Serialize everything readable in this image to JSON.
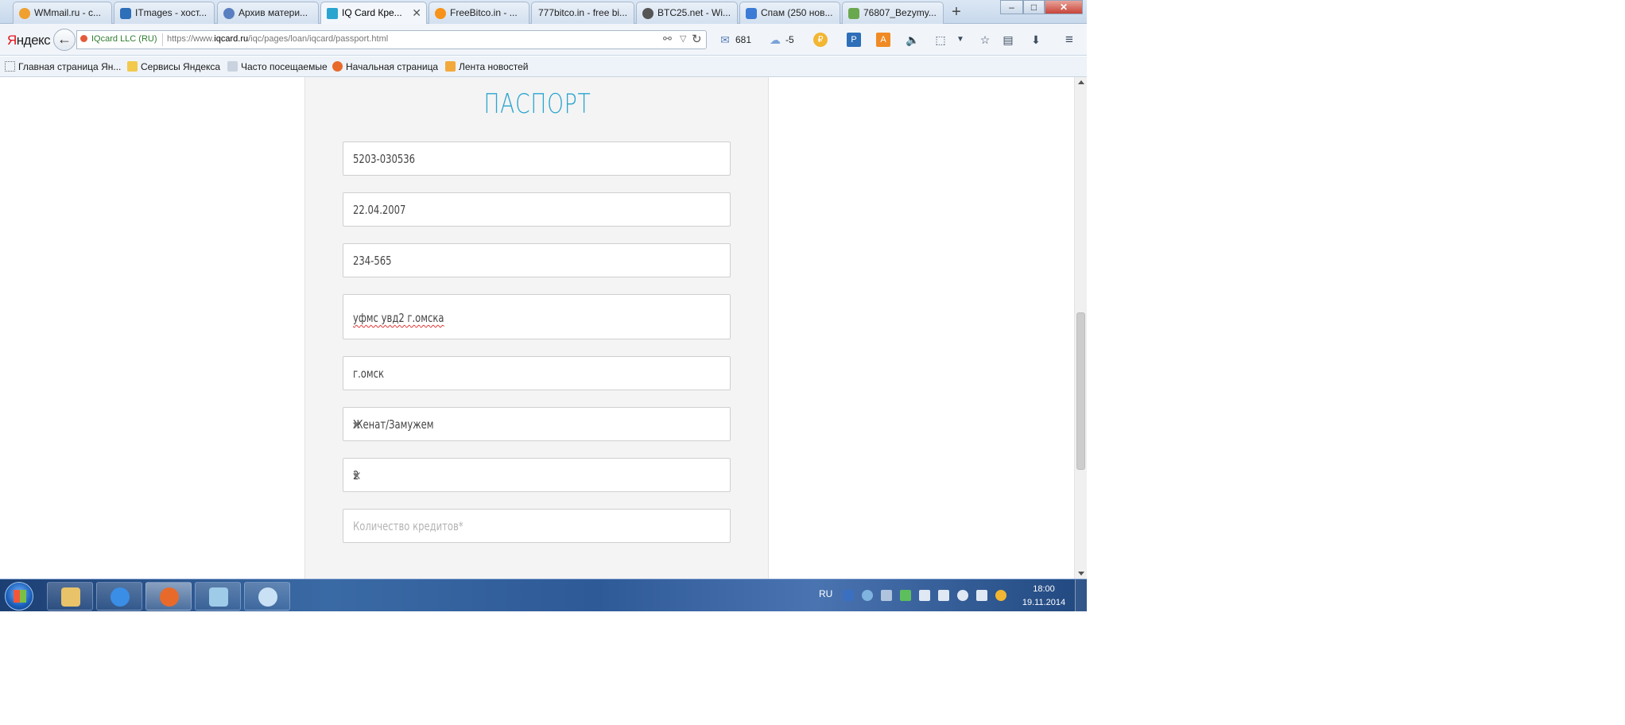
{
  "browser": {
    "tabs": [
      {
        "label": "WMmail.ru - с...",
        "icon_color": "#f0a030"
      },
      {
        "label": "ITmages - хост...",
        "icon_color": "#2d6fb8"
      },
      {
        "label": "Архив матери...",
        "icon_color": "#5a7fc0"
      },
      {
        "label": "IQ Card Кре...",
        "icon_color": "#2aa5cf",
        "active": true
      },
      {
        "label": "FreeBitco.in - ...",
        "icon_color": "#f7931a"
      },
      {
        "label": "777bitco.in - free bi...",
        "icon_color": "#d9d9d9"
      },
      {
        "label": "BTC25.net - Wi...",
        "icon_color": "#555555"
      },
      {
        "label": "Спам (250 нов...",
        "icon_color": "#3b7bd6"
      },
      {
        "label": "76807_Bezymy...",
        "icon_color": "#6aa84f"
      }
    ],
    "new_tab": "+",
    "window_buttons": {
      "minimize": "–",
      "maximize": "□",
      "close": "✕"
    },
    "nav": {
      "yandex_logo_first": "Я",
      "yandex_logo_rest": "ндекс",
      "site_identity": "IQcard LLC (RU)",
      "url_prefix": "https://www.",
      "url_domain": "iqcard.ru",
      "url_path": "/iqc/pages/loan/iqcard/passport.html",
      "mail_count": "681",
      "weather": "-5"
    },
    "bookmarks": [
      {
        "label": "Главная страница Ян...",
        "icon_color": "#ffffff"
      },
      {
        "label": "Сервисы Яндекса",
        "icon_color": "#f2c94c"
      },
      {
        "label": "Часто посещаемые",
        "icon_color": "#9aa7b8"
      },
      {
        "label": "Начальная страница",
        "icon_color": "#e86a2b"
      },
      {
        "label": "Лента новостей",
        "icon_color": "#f2a93b"
      }
    ]
  },
  "page": {
    "title": "ПАСПОРТ",
    "fields": [
      {
        "value": "5203-030536"
      },
      {
        "value": "22.04.2007"
      },
      {
        "value": "234-565"
      },
      {
        "value": "уфмс увд2 г.омска"
      },
      {
        "value": "г.омск"
      }
    ],
    "marital_status": {
      "value": "Женат/Замужем",
      "clear": "×"
    },
    "dependents": {
      "value": "2",
      "clear": "×"
    },
    "credits_count": {
      "placeholder": "Количество кредитов*"
    }
  },
  "taskbar": {
    "language": "RU",
    "time": "18:00",
    "date": "19.11.2014"
  },
  "colors": {
    "accent": "#2aa5cf",
    "taskbar": "#2e5a97",
    "form_bg": "#f4f4f4"
  }
}
